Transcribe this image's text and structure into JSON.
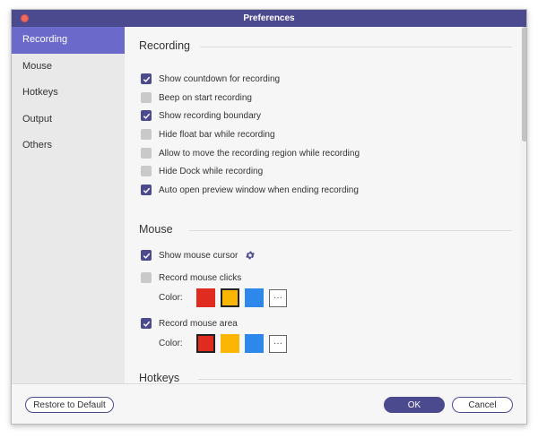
{
  "window": {
    "title": "Preferences"
  },
  "sidebar": {
    "items": [
      {
        "label": "Recording",
        "active": true
      },
      {
        "label": "Mouse"
      },
      {
        "label": "Hotkeys"
      },
      {
        "label": "Output"
      },
      {
        "label": "Others"
      }
    ]
  },
  "recording": {
    "title": "Recording",
    "options": [
      {
        "label": "Show countdown for recording",
        "checked": true
      },
      {
        "label": "Beep on start recording",
        "checked": false
      },
      {
        "label": "Show recording boundary",
        "checked": true
      },
      {
        "label": "Hide float bar while recording",
        "checked": false
      },
      {
        "label": "Allow to move the recording region while recording",
        "checked": false
      },
      {
        "label": "Hide Dock while recording",
        "checked": false
      },
      {
        "label": "Auto open preview window when ending recording",
        "checked": true
      }
    ]
  },
  "mouse": {
    "title": "Mouse",
    "show_cursor": {
      "label": "Show mouse cursor",
      "checked": true
    },
    "record_clicks": {
      "label": "Record mouse clicks",
      "checked": false
    },
    "clicks_color_label": "Color:",
    "record_area": {
      "label": "Record mouse area",
      "checked": true
    },
    "area_color_label": "Color:",
    "more_label": "···"
  },
  "hotkeys": {
    "title": "Hotkeys"
  },
  "footer": {
    "restore_label": "Restore to Default",
    "ok_label": "OK",
    "cancel_label": "Cancel"
  },
  "colors": {
    "accent": "#4c4a8f",
    "sidebar_active": "#6b69c9",
    "swatch_red": "#e02b20",
    "swatch_yellow": "#fbb604",
    "swatch_blue": "#2e87ea"
  }
}
